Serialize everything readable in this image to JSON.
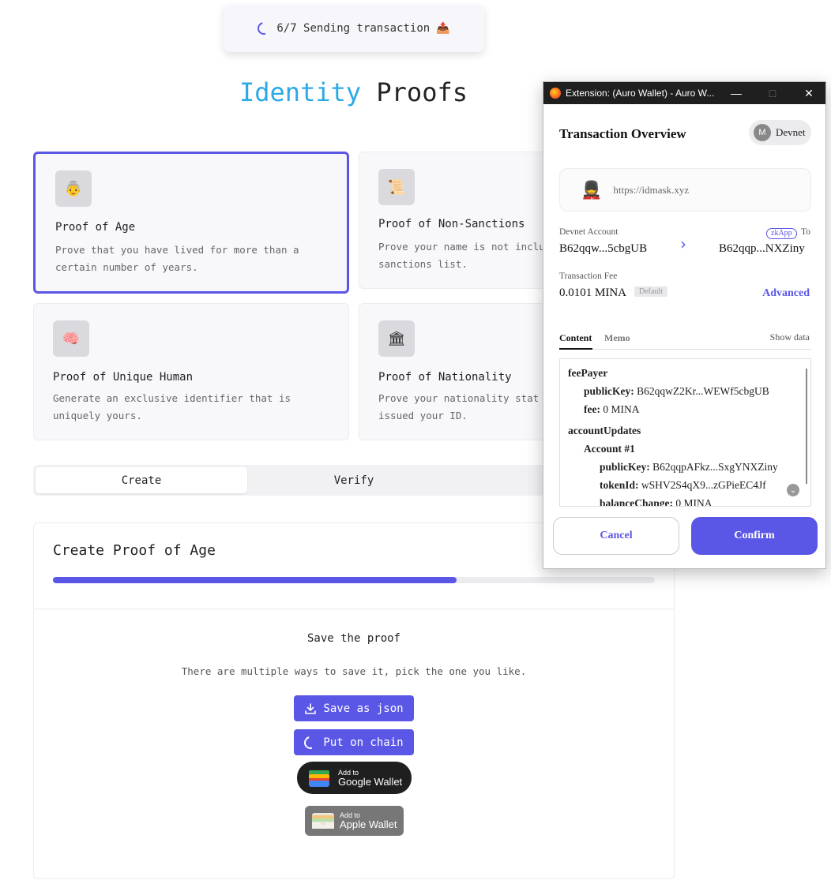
{
  "toast": {
    "text": "6/7 Sending transaction",
    "emoji": "📤"
  },
  "page_title": {
    "part1": "Identity",
    "part2": "Proofs"
  },
  "cards": [
    {
      "title": "Proof of Age",
      "desc_line1": "Prove that you have lived for more than a",
      "desc_line2": "certain number of years.",
      "icon": "👵"
    },
    {
      "title": "Proof of Non-Sanctions",
      "desc_line1": "Prove your name is not inclu",
      "desc_line2": "sanctions list.",
      "icon": "📜"
    },
    {
      "title": "Proof of Unique Human",
      "desc_line1": "Generate an exclusive identifier that is",
      "desc_line2": "uniquely yours.",
      "icon": "🧠"
    },
    {
      "title": "Proof of Nationality",
      "desc_line1": "Prove your nationality stat",
      "desc_line2": "issued your ID.",
      "icon": "🏛"
    }
  ],
  "tabs": {
    "create": "Create",
    "verify": "Verify"
  },
  "panel": {
    "title": "Create Proof of Age",
    "progress": 0.67,
    "save_title": "Save the proof",
    "save_desc": "There are multiple ways to save it, pick the one you like.",
    "save_json": "Save as json",
    "put_chain": "Put on chain",
    "google_small": "Add to",
    "google_big": "Google Wallet",
    "apple_small": "Add to",
    "apple_big": "Apple Wallet"
  },
  "extension": {
    "window_title": "Extension: (Auro Wallet) - Auro W...",
    "title": "Transaction Overview",
    "network": "Devnet",
    "site_url": "https://idmask.xyz",
    "from_label": "Devnet Account",
    "from_value": "B62qqw...5cbgUB",
    "zkapp_badge": "zkApp",
    "to_label": "To",
    "to_value": "B62qqp...NXZiny",
    "fee_label": "Transaction Fee",
    "fee_value": "0.0101 MINA",
    "fee_badge": "Default",
    "advanced": "Advanced",
    "tab_content": "Content",
    "tab_memo": "Memo",
    "show_data": "Show data",
    "json": {
      "fee_payer": "feePayer",
      "public_key_label": "publicKey:",
      "public_key_value": "B62qqwZ2Kr...WEWf5cbgUB",
      "fee_label": "fee:",
      "fee_value": "0 MINA",
      "account_updates": "accountUpdates",
      "account1": "Account #1",
      "acc_public_key_label": "publicKey:",
      "acc_public_key_value": "B62qqpAFkz...SxgYNXZiny",
      "token_id_label": "tokenId:",
      "token_id_value": "wSHV2S4qX9...zGPieEC4Jf",
      "balance_change_label": "balanceChange:",
      "balance_change_value": "0 MINA"
    },
    "cancel": "Cancel",
    "confirm": "Confirm"
  },
  "colors": {
    "accent": "#5b57e6",
    "title_blue": "#2aa9e6"
  }
}
